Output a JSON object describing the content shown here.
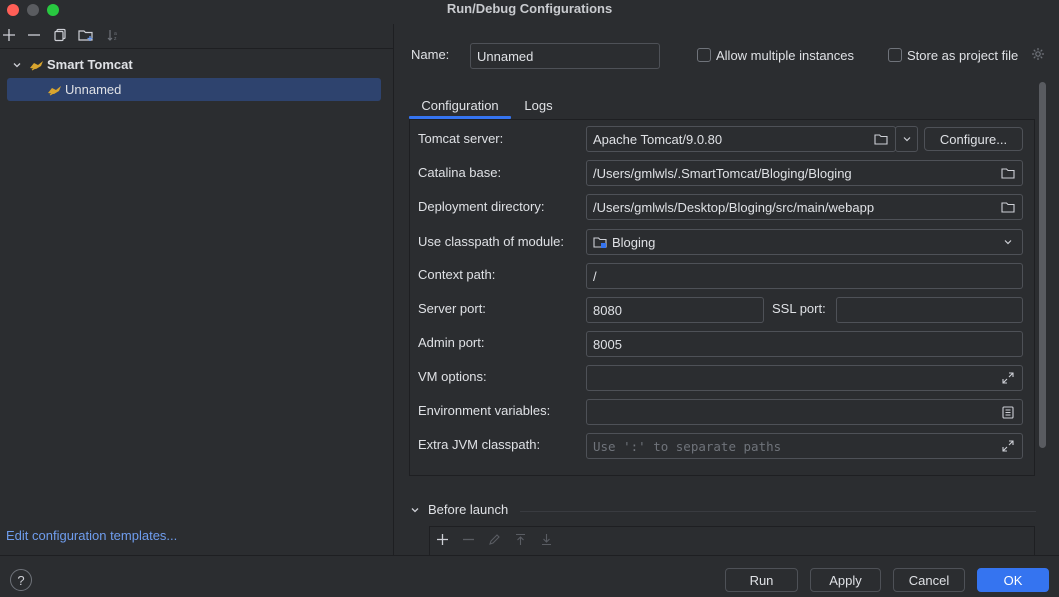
{
  "window": {
    "title": "Run/Debug Configurations"
  },
  "left_toolbar": {
    "icons": [
      "plus-icon",
      "minus-icon",
      "copy-icon",
      "new-folder-icon",
      "sort-icon"
    ]
  },
  "tree": {
    "group": {
      "label": "Smart Tomcat"
    },
    "item": {
      "label": "Unnamed"
    }
  },
  "edit_templates_link": "Edit configuration templates...",
  "form": {
    "name_label": "Name:",
    "name_value": "Unnamed",
    "allow_multiple_label": "Allow multiple instances",
    "store_project_label": "Store as project file",
    "tabs": [
      "Configuration",
      "Logs"
    ],
    "tomcat_server_label": "Tomcat server:",
    "tomcat_server_value": "Apache Tomcat/9.0.80",
    "configure_button": "Configure...",
    "catalina_base_label": "Catalina base:",
    "catalina_base_value": "/Users/gmlwls/.SmartTomcat/Bloging/Bloging",
    "deployment_dir_label": "Deployment directory:",
    "deployment_dir_value": "/Users/gmlwls/Desktop/Bloging/src/main/webapp",
    "classpath_label": "Use classpath of module:",
    "classpath_value": "Bloging",
    "context_path_label": "Context path:",
    "context_path_value": "/",
    "server_port_label": "Server port:",
    "server_port_value": "8080",
    "ssl_port_label": "SSL port:",
    "ssl_port_value": "",
    "admin_port_label": "Admin port:",
    "admin_port_value": "8005",
    "vm_options_label": "VM options:",
    "vm_options_value": "",
    "env_vars_label": "Environment variables:",
    "env_vars_value": "",
    "extra_jvm_label": "Extra JVM classpath:",
    "extra_jvm_placeholder": "Use ':' to separate paths"
  },
  "before_launch": {
    "label": "Before launch",
    "icons": [
      "add-icon",
      "remove-icon",
      "edit-icon",
      "move-up-icon",
      "move-down-icon"
    ]
  },
  "buttons": {
    "help": "?",
    "run": "Run",
    "apply": "Apply",
    "cancel": "Cancel",
    "ok": "OK"
  },
  "colors": {
    "accent": "#3574f0",
    "selection": "#2e436e",
    "link": "#6f9dee",
    "background": "#2b2d30"
  }
}
